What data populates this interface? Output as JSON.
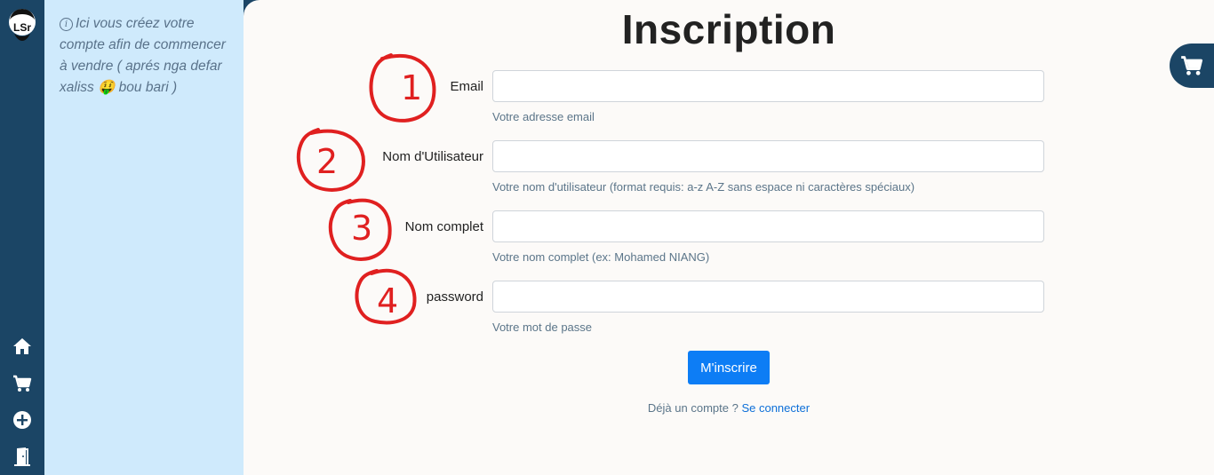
{
  "sidebar": {
    "logo_text": "LSr",
    "icons": [
      "home-icon",
      "cart-icon",
      "plus-circle-icon",
      "logout-door-icon"
    ]
  },
  "info": {
    "text": "Ici vous créez votre compte afin de commencer à vendre ( aprés nga defar xaliss 🤑 bou bari )"
  },
  "page": {
    "title": "Inscription"
  },
  "form": {
    "email": {
      "label": "Email",
      "help": "Votre adresse email",
      "value": ""
    },
    "username": {
      "label": "Nom d'Utilisateur",
      "help": "Votre nom d'utilisateur (format requis: a-z A-Z sans espace ni caractères spéciaux)",
      "value": ""
    },
    "fullname": {
      "label": "Nom complet",
      "help": "Votre nom complet (ex: Mohamed NIANG)",
      "value": ""
    },
    "password": {
      "label": "password",
      "help": "Votre mot de passe",
      "value": ""
    },
    "submit_label": "M'inscrire"
  },
  "login": {
    "prompt": "Déjà un compte ?",
    "link": "Se connecter"
  },
  "annotations": [
    "1",
    "2",
    "3",
    "4"
  ],
  "colors": {
    "rail": "#1b4565",
    "info_panel": "#cfeafc",
    "main_bg": "#fcfaf8",
    "primary": "#0d7df5",
    "annotation": "#e02020"
  }
}
